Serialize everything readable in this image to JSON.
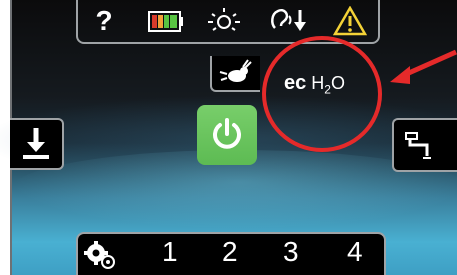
{
  "top_icons": [
    {
      "name": "help-icon",
      "label": "?"
    },
    {
      "name": "battery-icon"
    },
    {
      "name": "light-icon"
    },
    {
      "name": "audio-icon"
    },
    {
      "name": "warning-icon"
    }
  ],
  "ec_label": {
    "ec": "ec",
    "h": "H",
    "sub": "2",
    "o": "O"
  },
  "mode_numbers": [
    "1",
    "2",
    "3",
    "4"
  ],
  "colors": {
    "power_green": "#66c25a",
    "battery_red": "#d93a2b",
    "battery_orange": "#f2a23a",
    "battery_green": "#58c442",
    "warning_yellow": "#f4d237",
    "callout_red": "#e52a2a"
  }
}
